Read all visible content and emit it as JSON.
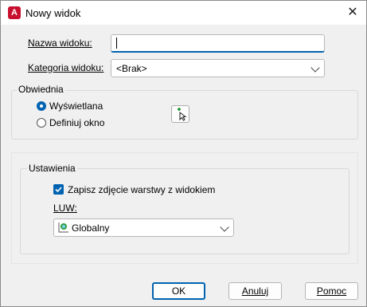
{
  "window": {
    "title": "Nowy widok",
    "close_glyph": "✕",
    "app_icon_letter": "A"
  },
  "form": {
    "name_label": "Nazwa widoku:",
    "name_value": "",
    "category_label": "Kategoria widoku:",
    "category_value": "<Brak>"
  },
  "boundary": {
    "title": "Obwiednia",
    "options": [
      {
        "label": "Wyświetlana",
        "selected": true
      },
      {
        "label": "Definiuj okno",
        "selected": false
      }
    ]
  },
  "settings": {
    "title": "Ustawienia",
    "save_layer_snapshot_label": "Zapisz zdjęcie warstwy z widokiem",
    "save_layer_snapshot_checked": true,
    "ucs_label": "LUW:",
    "ucs_value": "Globalny"
  },
  "buttons": {
    "ok": "OK",
    "cancel": "Anuluj",
    "help": "Pomoc"
  },
  "colors": {
    "accent": "#0063b1",
    "app_icon": "#c8102e",
    "ucs_icon_green": "#2e9e3e"
  }
}
